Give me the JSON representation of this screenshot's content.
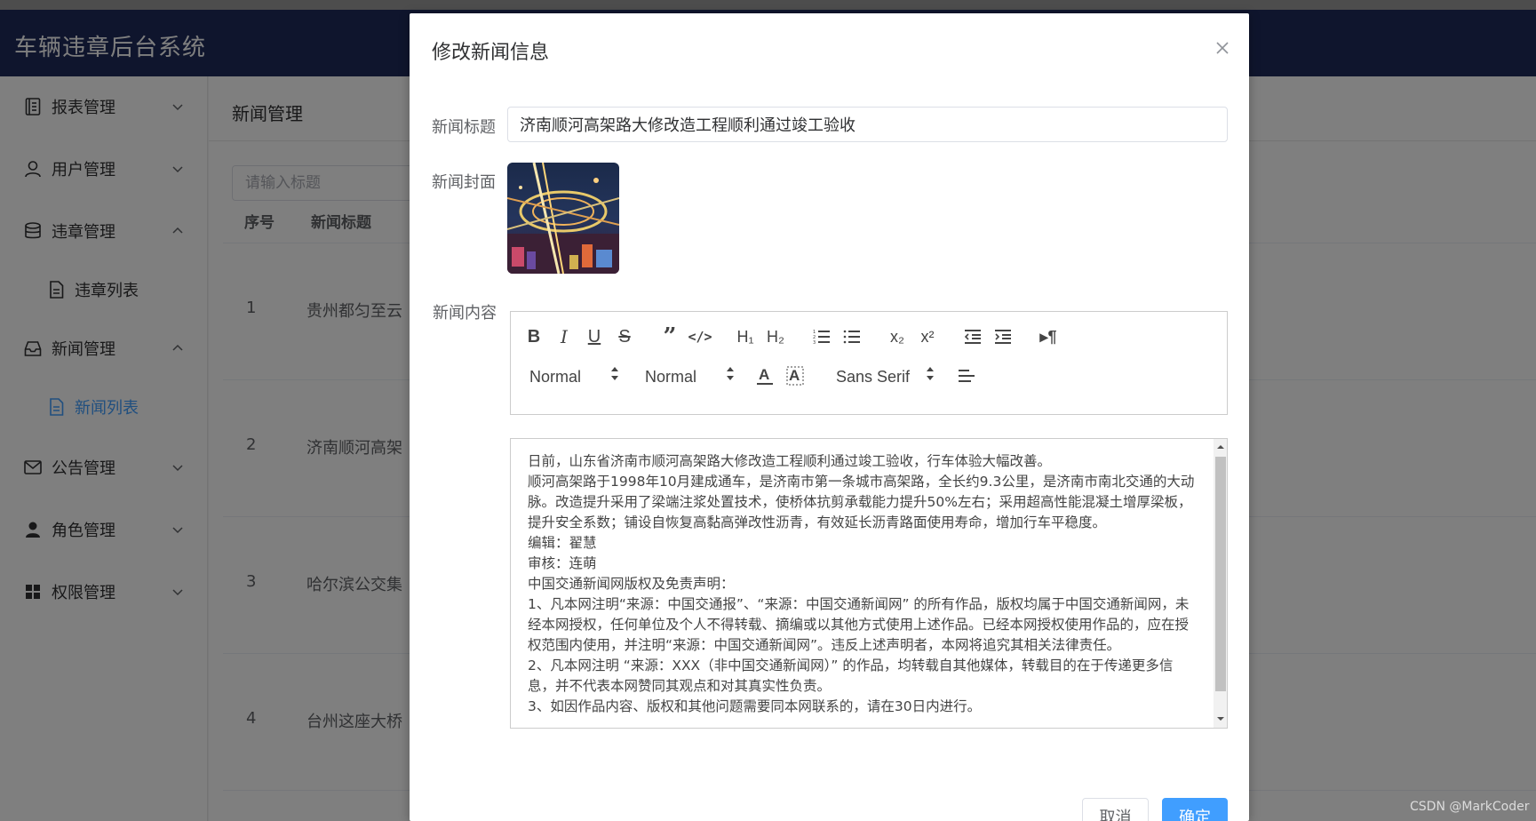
{
  "header": {
    "title": "车辆违章后台系统"
  },
  "sidebar": {
    "items": [
      {
        "label": "报表管理"
      },
      {
        "label": "用户管理"
      },
      {
        "label": "违章管理"
      },
      {
        "label": "违章列表"
      },
      {
        "label": "新闻管理"
      },
      {
        "label": "新闻列表"
      },
      {
        "label": "公告管理"
      },
      {
        "label": "角色管理"
      },
      {
        "label": "权限管理"
      }
    ]
  },
  "main": {
    "page_title": "新闻管理",
    "search_placeholder": "请输入标题",
    "columns": [
      "序号",
      "新闻标题"
    ],
    "rows": [
      {
        "index": "1",
        "title": "贵州都匀至云"
      },
      {
        "index": "2",
        "title": "济南顺河高架"
      },
      {
        "index": "3",
        "title": "哈尔滨公交集"
      },
      {
        "index": "4",
        "title": "台州这座大桥"
      }
    ]
  },
  "dialog": {
    "title": "修改新闻信息",
    "labels": {
      "news_title": "新闻标题",
      "news_cover": "新闻封面",
      "news_content": "新闻内容"
    },
    "news_title_value": "济南顺河高架路大修改造工程顺利通过竣工验收",
    "toolbar": {
      "header_picker": "Normal",
      "size_picker": "Normal",
      "font_picker": "Sans Serif"
    },
    "content": [
      "日前，山东省济南市顺河高架路大修改造工程顺利通过竣工验收，行车体验大幅改善。",
      "顺河高架路于1998年10月建成通车，是济南市第一条城市高架路，全长约9.3公里，是济南市南北交通的大动脉。改造提升采用了梁端注浆处置技术，使桥体抗剪承载能力提升50%左右；采用超高性能混凝土增厚梁板，提升安全系数；铺设自恢复高黏高弹改性沥青，有效延长沥青路面使用寿命，增加行车平稳度。",
      "编辑：翟慧",
      "审核：连萌",
      "中国交通新闻网版权及免责声明：",
      "1、凡本网注明“来源：中国交通报”、“来源：中国交通新闻网” 的所有作品，版权均属于中国交通新闻网，未经本网授权，任何单位及个人不得转载、摘编或以其他方式使用上述作品。已经本网授权使用作品的，应在授权范围内使用，并注明“来源：中国交通新闻网”。违反上述声明者，本网将追究其相关法律责任。",
      "2、凡本网注明 “来源：XXX（非中国交通新闻网）” 的作品，均转载自其他媒体，转载目的在于传递更多信息，并不代表本网赞同其观点和对其真实性负责。",
      "3、如因作品内容、版权和其他问题需要同本网联系的，请在30日内进行。"
    ],
    "buttons": {
      "cancel": "取消",
      "confirm": "确定"
    }
  },
  "watermark": "CSDN @MarkCoder"
}
